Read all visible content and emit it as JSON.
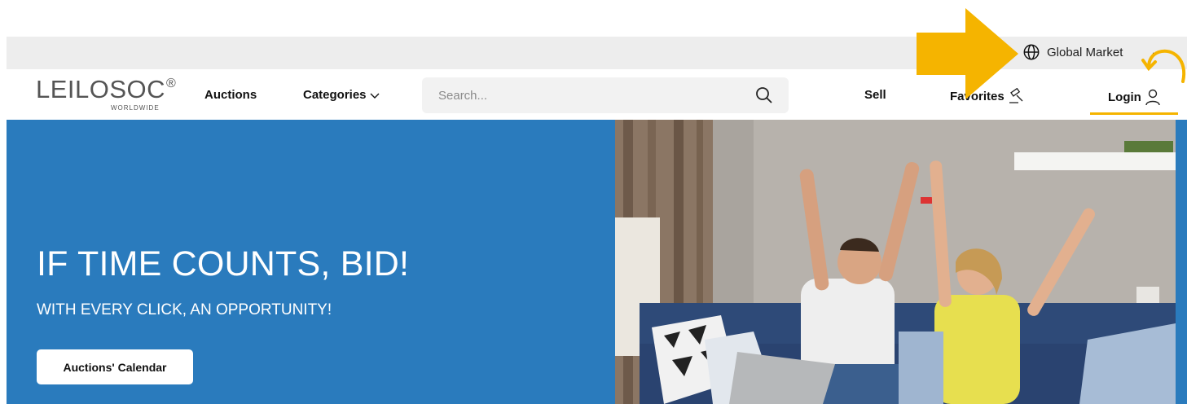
{
  "utility": {
    "market_label": "Global Market",
    "chevron": "⌄"
  },
  "logo": {
    "main": "LEILOSOC",
    "reg": "®",
    "sub": "WORLDWIDE"
  },
  "nav": {
    "auctions": "Auctions",
    "categories": "Categories",
    "sell": "Sell",
    "favorites": "Favorites",
    "login": "Login"
  },
  "search": {
    "placeholder": "Search..."
  },
  "hero": {
    "title": "IF TIME COUNTS, BID!",
    "subtitle": "WITH EVERY CLICK, AN OPPORTUNITY!",
    "cta_label": "Auctions' Calendar"
  },
  "icons": {
    "globe": "globe-icon",
    "search": "search-icon",
    "favorites": "gavel-icon",
    "login": "user-icon",
    "categories_chevron": "chevron-down-icon"
  },
  "colors": {
    "hero_blue": "#2a7bbd",
    "annotation": "#f5b400",
    "utility_bar": "#ededed"
  }
}
